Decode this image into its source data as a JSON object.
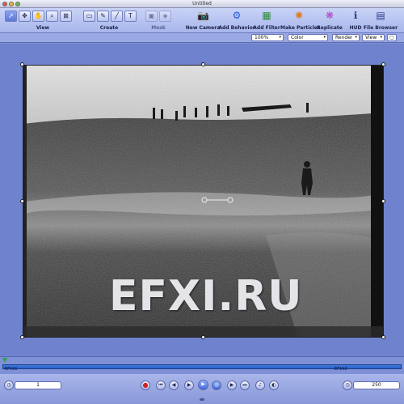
{
  "window": {
    "title": "Untitled"
  },
  "toolbar": {
    "group_labels": {
      "view": "View",
      "create": "Create",
      "mask": "Mask"
    },
    "view_tools": [
      "arrow-select-tool",
      "transform-tool",
      "hand-tool",
      "zoom-tool",
      "crop-tool"
    ],
    "create_tools": [
      "rectangle-tool",
      "bezier-tool",
      "paint-stroke-tool",
      "text-tool"
    ],
    "mask_tools": [
      "rect-mask-tool",
      "bezier-mask-tool"
    ],
    "buttons": [
      {
        "label": "New Camera",
        "icon": "camera-icon"
      },
      {
        "label": "Add Behavior",
        "icon": "gear-icon"
      },
      {
        "label": "Add Filter",
        "icon": "filter-icon"
      },
      {
        "label": "Make Particles",
        "icon": "particles-icon"
      },
      {
        "label": "Replicate",
        "icon": "replicate-icon"
      },
      {
        "label": "HUD",
        "icon": "hud-icon"
      },
      {
        "label": "File Browser",
        "icon": "file-browser-icon"
      }
    ]
  },
  "options": {
    "zoom": "100%",
    "channels": "Color",
    "render": "Render",
    "view": "View"
  },
  "canvas": {
    "watermark": "EFXI.RU"
  },
  "timeline": {
    "start_label": "1",
    "end_label": "250",
    "in_marker": "EF191",
    "out_marker": "EF192"
  },
  "transport": {
    "current_frame": "1",
    "duration": "250",
    "buttons": [
      "record",
      "go-to-start",
      "previous-frame",
      "play",
      "loop",
      "next-frame",
      "go-to-end",
      "audio",
      "mute"
    ]
  },
  "colors": {
    "chrome": "#7d8fd3",
    "toolbar": "#b8c4f0",
    "timeline_bar": "#3f7ce0"
  }
}
